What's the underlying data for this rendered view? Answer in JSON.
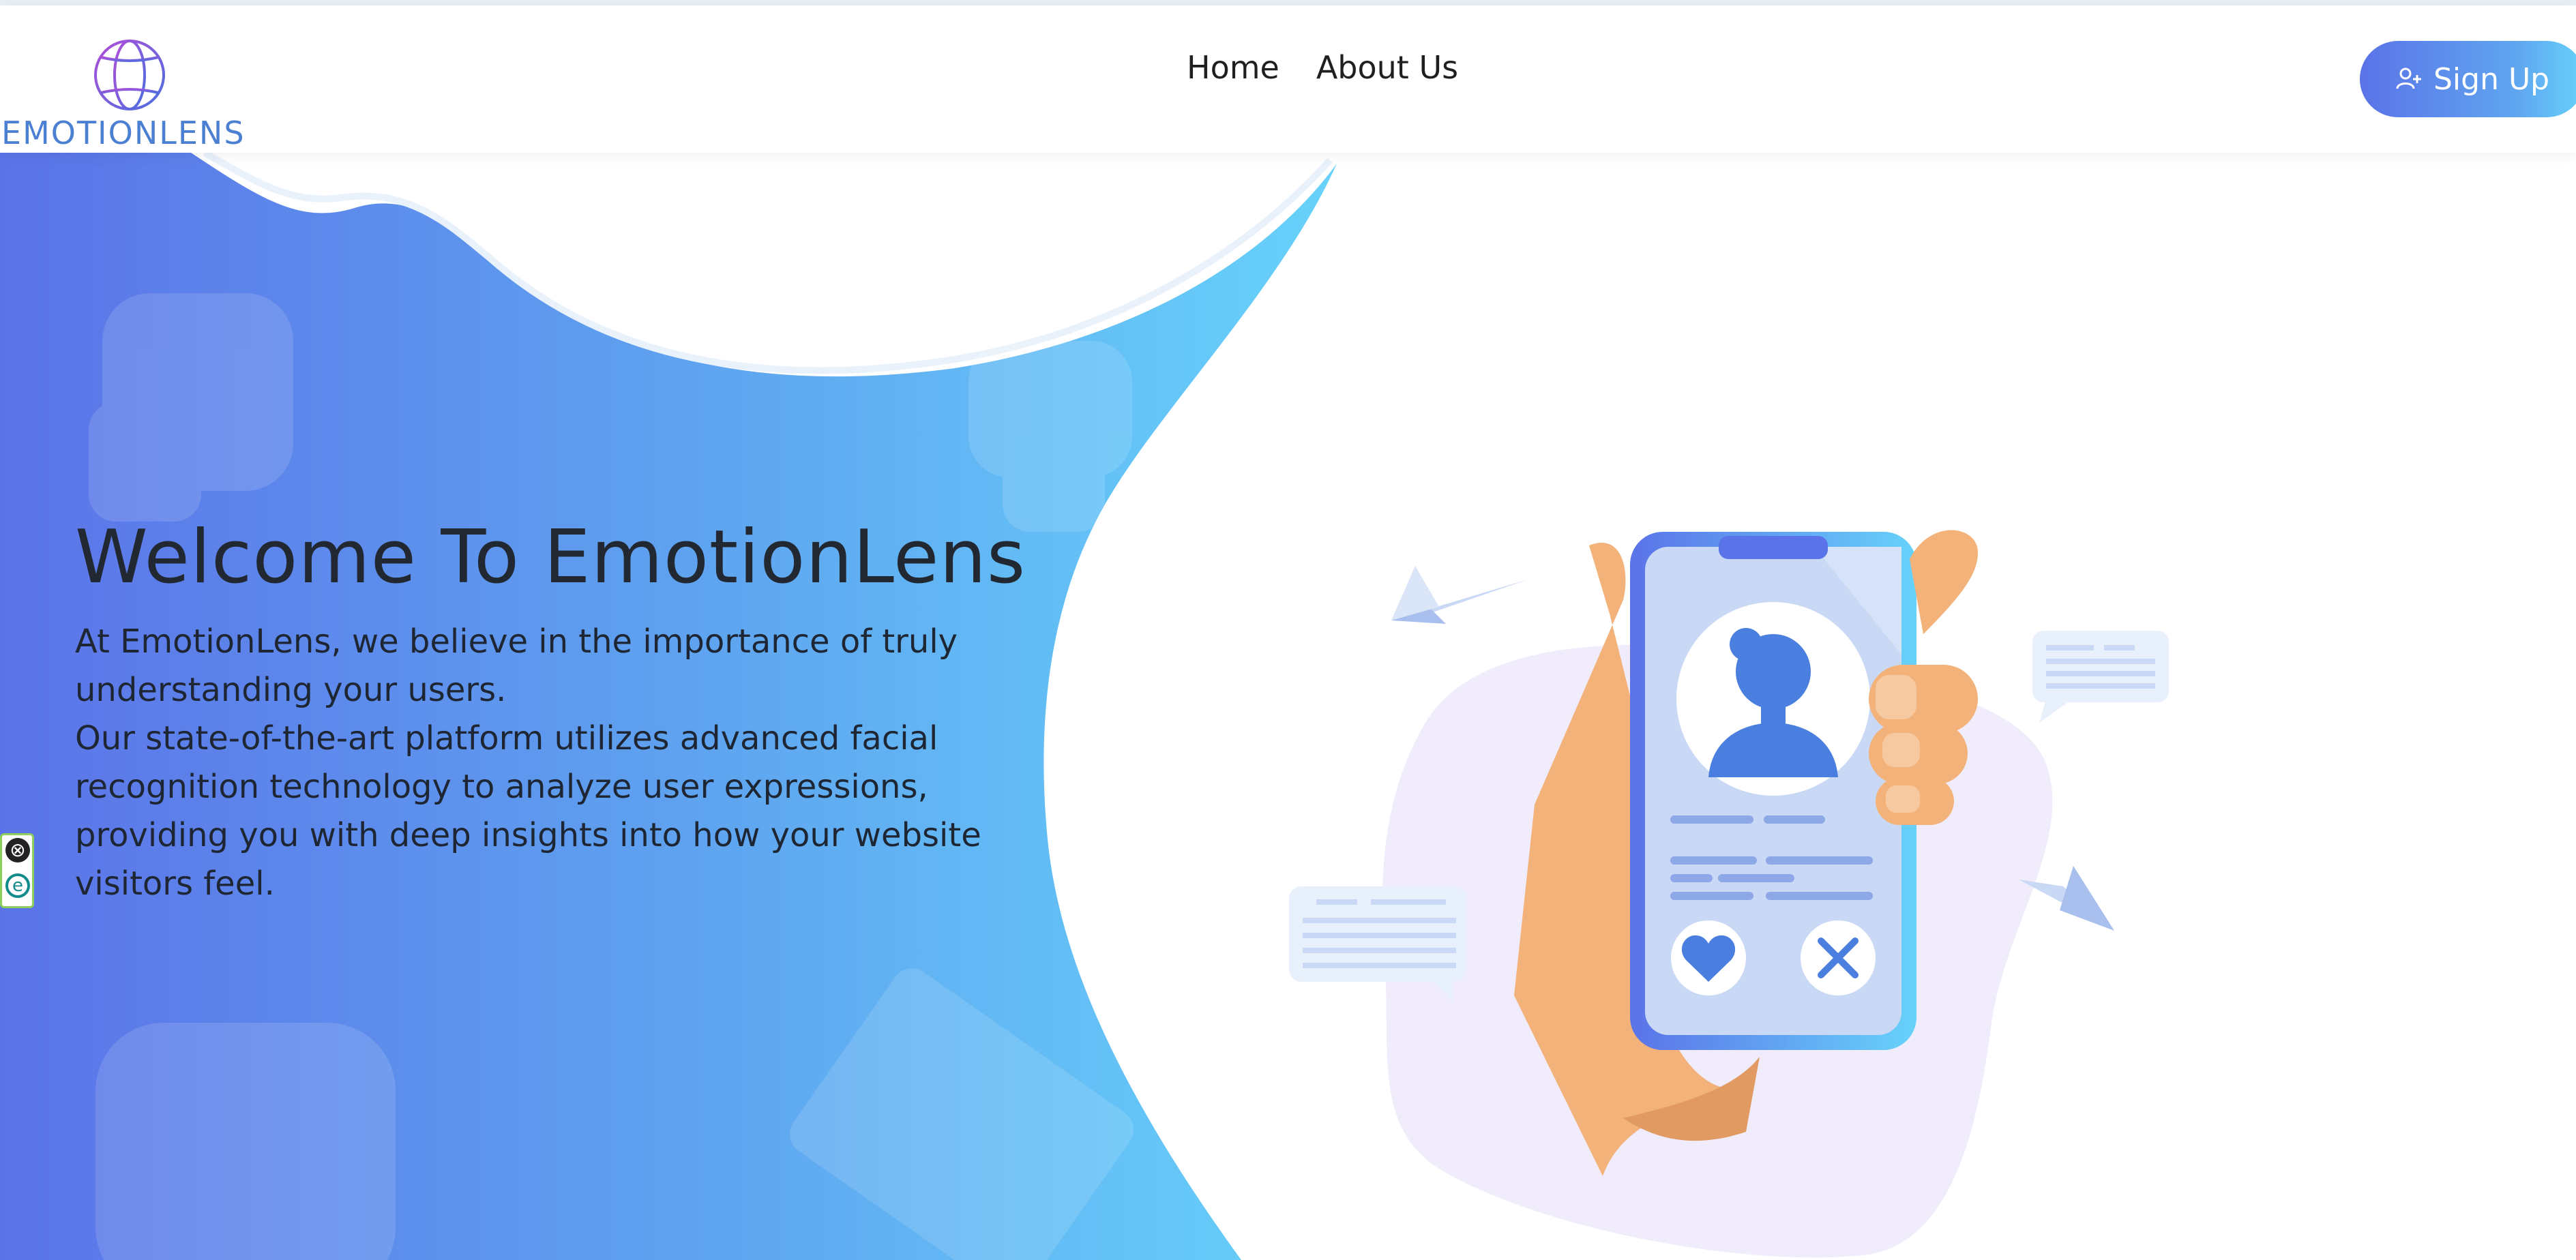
{
  "brand": {
    "name": "EMOTIONLENS",
    "logo_icon": "globe-icon"
  },
  "nav": {
    "items": [
      {
        "label": "Home"
      },
      {
        "label": "About Us"
      }
    ]
  },
  "signup": {
    "label": "Sign Up",
    "icon": "user-plus-icon"
  },
  "hero": {
    "title": "Welcome To EmotionLens",
    "paragraph1": "At EmotionLens, we believe in the importance of truly understanding your users.",
    "paragraph2": "Our state-of-the-art platform utilizes advanced facial recognition technology to analyze user expressions, providing you with deep insights into how your website visitors feel."
  },
  "extension": {
    "close_glyph": "⊗",
    "logo_letter": "e"
  },
  "colors": {
    "gradient_start": "#5b73e8",
    "gradient_end": "#67d2fa",
    "brand_text": "#4a7fd2",
    "hand": "#f2b27a",
    "phone_screen": "#c9d8f5",
    "blob": "#f1ecfb"
  }
}
